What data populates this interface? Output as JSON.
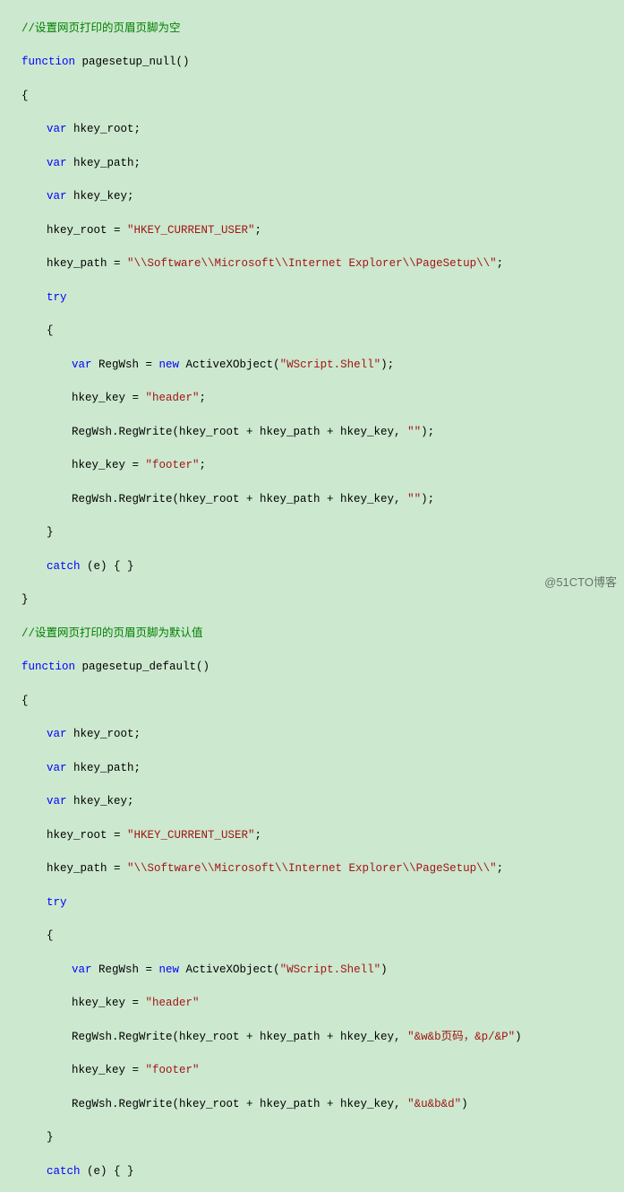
{
  "func1": {
    "comment": "//设置网页打印的页眉页脚为空",
    "decl_kw": "function",
    "decl_name": " pagesetup_null()",
    "open_brace": "{",
    "var_kw": "var",
    "var1_name": " hkey_root;",
    "var2_name": " hkey_path;",
    "var3_name": " hkey_key;",
    "root_assign_lhs": "hkey_root = ",
    "root_assign_str": "\"HKEY_CURRENT_USER\"",
    "root_assign_end": ";",
    "path_assign_lhs": "hkey_path = ",
    "path_assign_str": "\"\\\\Software\\\\Microsoft\\\\Internet Explorer\\\\PageSetup\\\\\"",
    "path_assign_end": ";",
    "try_kw": "try",
    "try_open": "{",
    "regwsh_var_kw": "var",
    "regwsh_between": " RegWsh = ",
    "new_kw": "new",
    "regwsh_after_new": " ActiveXObject(",
    "regwsh_arg": "\"WScript.Shell\"",
    "regwsh_close": ");",
    "hk_header_lhs": "hkey_key = ",
    "hk_header_str": "\"header\"",
    "hk_header_end": ";",
    "write1_full": "RegWsh.RegWrite(hkey_root + hkey_path + hkey_key, ",
    "write1_str": "\"\"",
    "write1_end": ");",
    "hk_footer_lhs": "hkey_key = ",
    "hk_footer_str": "\"footer\"",
    "hk_footer_end": ";",
    "write2_full": "RegWsh.RegWrite(hkey_root + hkey_path + hkey_key, ",
    "write2_str": "\"\"",
    "write2_end": ");",
    "try_close": "}",
    "catch_kw": "catch",
    "catch_rest": " (e) { }",
    "close_brace": "}"
  },
  "func2": {
    "comment": "//设置网页打印的页眉页脚为默认值",
    "decl_kw": "function",
    "decl_name": " pagesetup_default()",
    "open_brace": "{",
    "var_kw": "var",
    "var1_name": " hkey_root;",
    "var2_name": " hkey_path;",
    "var3_name": " hkey_key;",
    "root_assign_lhs": "hkey_root = ",
    "root_assign_str": "\"HKEY_CURRENT_USER\"",
    "root_assign_end": ";",
    "path_assign_lhs": "hkey_path = ",
    "path_assign_str": "\"\\\\Software\\\\Microsoft\\\\Internet Explorer\\\\PageSetup\\\\\"",
    "path_assign_end": ";",
    "try_kw": "try",
    "try_open": "{",
    "regwsh_var_kw": "var",
    "regwsh_between": " RegWsh = ",
    "new_kw": "new",
    "regwsh_after_new": " ActiveXObject(",
    "regwsh_arg": "\"WScript.Shell\"",
    "regwsh_close": ")",
    "hk_header_lhs": "hkey_key = ",
    "hk_header_str": "\"header\"",
    "write1_full": "RegWsh.RegWrite(hkey_root + hkey_path + hkey_key, ",
    "write1_str": "\"&w&b页码，&p/&P\"",
    "write1_end": ")",
    "hk_footer_lhs": "hkey_key = ",
    "hk_footer_str": "\"footer\"",
    "write2_full": "RegWsh.RegWrite(hkey_root + hkey_path + hkey_key, ",
    "write2_str": "\"&u&b&d\"",
    "write2_end": ")",
    "try_close": "}",
    "catch_kw": "catch",
    "catch_rest": " (e) { }"
  },
  "watermark": "@51CTO博客"
}
